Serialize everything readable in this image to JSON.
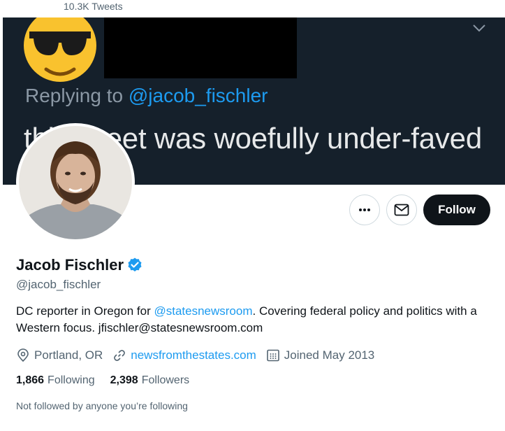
{
  "header": {
    "tweet_count": "10.3K Tweets"
  },
  "banner": {
    "replying_prefix": "Replying to ",
    "replying_handle": "@jacob_fischler",
    "text": "this tweet was woefully under-faved"
  },
  "actions": {
    "follow_label": "Follow",
    "more_icon": "more-icon",
    "message_icon": "mail-icon"
  },
  "profile": {
    "name": "Jacob Fischler",
    "handle": "@jacob_fischler",
    "bio_prefix": "DC reporter in Oregon for ",
    "bio_mention": "@statesnewsroom",
    "bio_suffix": ". Covering federal policy and politics with a Western focus. jfischler@statesnewsroom.com",
    "location": "Portland, OR",
    "website": "newsfromthestates.com",
    "joined": "Joined May 2013",
    "following_count": "1,866",
    "following_label": "Following",
    "followers_count": "2,398",
    "followers_label": "Followers",
    "social_context": "Not followed by anyone you’re following"
  },
  "colors": {
    "accent": "#1d9bf0",
    "banner_bg": "#15202b",
    "text_primary": "#0f1419",
    "text_secondary": "#536471"
  }
}
